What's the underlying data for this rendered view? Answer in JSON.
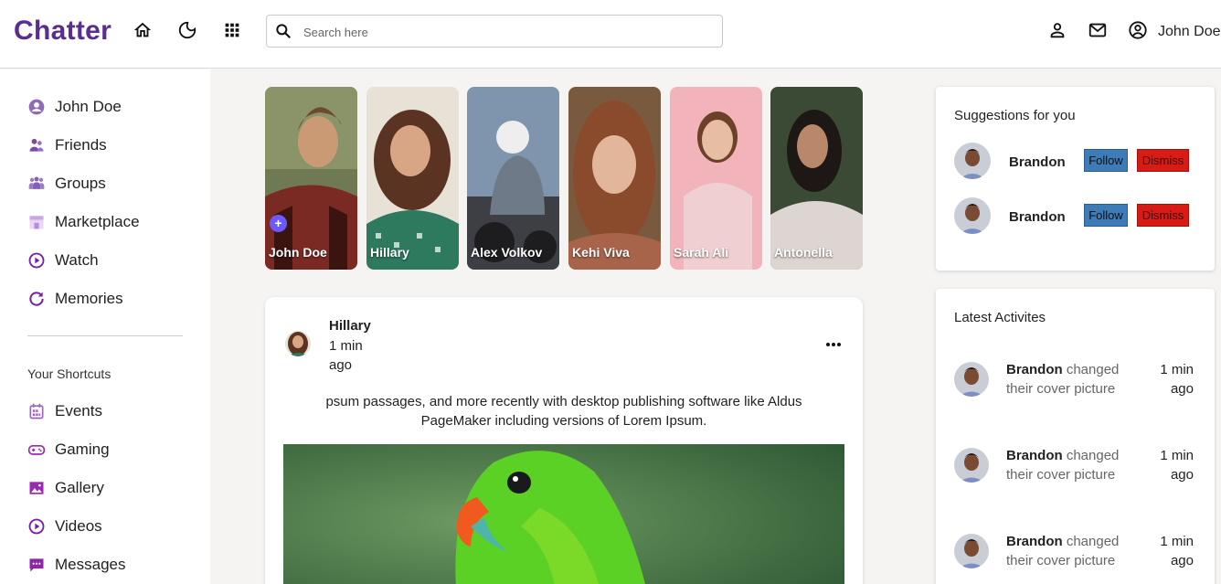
{
  "app": {
    "name": "Chatter",
    "brand_color": "#5a2d91"
  },
  "topbar": {
    "icons": [
      "home-icon",
      "moon-icon",
      "apps-grid-icon",
      "person-icon",
      "mail-icon",
      "account-circle-icon"
    ],
    "search_placeholder": "Search here",
    "user_name": "John Doe"
  },
  "sidebar": {
    "items": [
      {
        "label": "John Doe",
        "icon": "account-circle-icon"
      },
      {
        "label": "Friends",
        "icon": "friends-icon"
      },
      {
        "label": "Groups",
        "icon": "groups-icon"
      },
      {
        "label": "Marketplace",
        "icon": "storefront-icon"
      },
      {
        "label": "Watch",
        "icon": "play-circle-icon"
      },
      {
        "label": "Memories",
        "icon": "history-icon"
      }
    ],
    "shortcuts_title": "Your Shortcuts",
    "shortcuts": [
      {
        "label": "Events",
        "icon": "calendar-icon"
      },
      {
        "label": "Gaming",
        "icon": "gamepad-icon"
      },
      {
        "label": "Gallery",
        "icon": "image-icon"
      },
      {
        "label": "Videos",
        "icon": "play-circle-icon"
      },
      {
        "label": "Messages",
        "icon": "message-icon"
      }
    ]
  },
  "stories": [
    {
      "name": "John Doe",
      "add": "+"
    },
    {
      "name": "Hillary"
    },
    {
      "name": "Alex Volkov"
    },
    {
      "name": "Kehi Viva"
    },
    {
      "name": "Sarah Ali"
    },
    {
      "name": "Antonella"
    }
  ],
  "post": {
    "author": "Hillary",
    "time": "1 min ago",
    "text": "psum passages, and more recently with desktop publishing software like Aldus PageMaker including versions of Lorem Ipsum."
  },
  "suggestions": {
    "title": "Suggestions for you",
    "follow_label": "Follow",
    "dismiss_label": "Dismiss",
    "items": [
      {
        "name": "Brandon"
      },
      {
        "name": "Brandon"
      }
    ]
  },
  "activities": {
    "title": "Latest Activites",
    "items": [
      {
        "name": "Brandon",
        "action": "changed their cover picture",
        "time": "1 min ago"
      },
      {
        "name": "Brandon",
        "action": "changed their cover picture",
        "time": "1 min ago"
      },
      {
        "name": "Brandon",
        "action": "changed their cover picture",
        "time": "1 min ago"
      }
    ]
  }
}
